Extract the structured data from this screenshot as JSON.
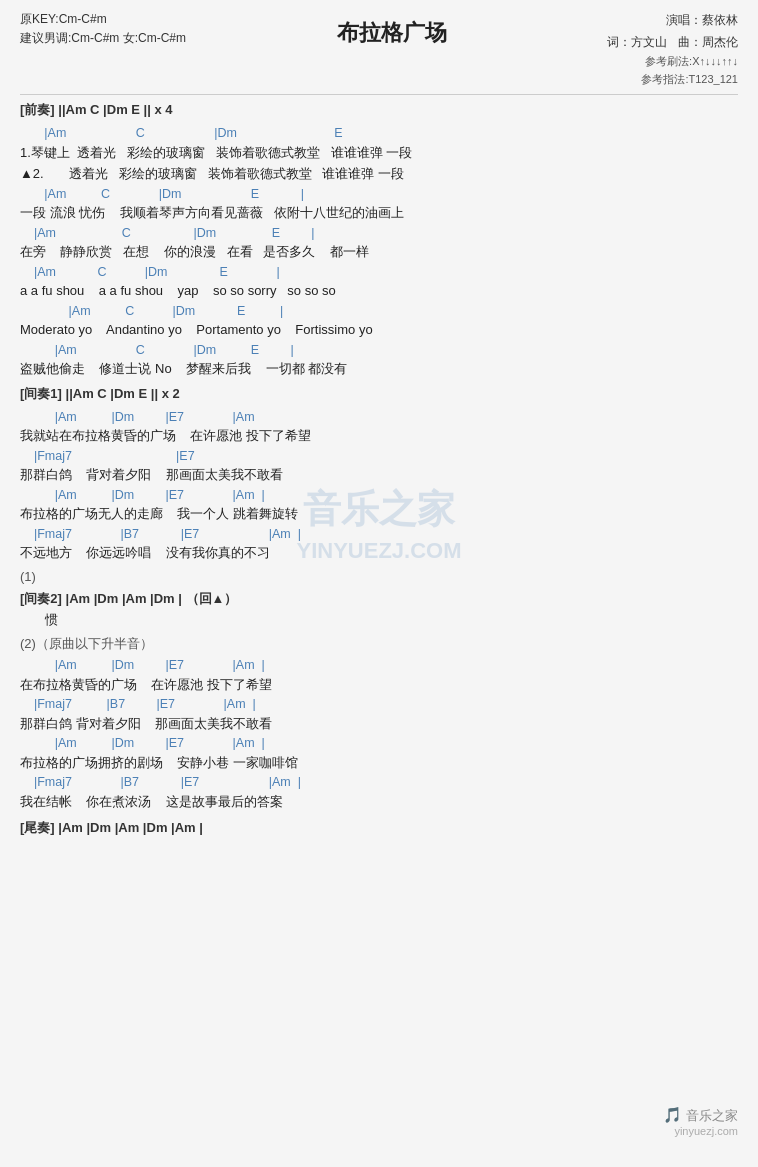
{
  "title": "布拉格广场",
  "meta": {
    "original_key": "原KEY:Cm-C#m",
    "suggested_key": "建议男调:Cm-C#m 女:Cm-C#m",
    "singer": "演唱：蔡依林",
    "lyricist": "词：方文山",
    "composer": "曲：周杰伦",
    "strumming_method": "参考刷法:X↑↓↓↓↑↑↓",
    "finger_method": "参考指法:T123_121"
  },
  "prelude": "[前奏] ||Am  C  |Dm  E  || x 4",
  "verse1_chords1": "       |Am                    C                    |Dm                            E",
  "verse1_lyric1": "1.琴键上  透着光   彩绘的玻璃窗   装饰着歌德式教堂   谁谁谁弹 一段",
  "verse1_lyric2": "▲2.       透着光   彩绘的玻璃窗   装饰着歌德式教堂   谁谁谁弹 一段",
  "verse1_chords2": "       |Am          C              |Dm                    E            |",
  "verse1_lyric3": "一段 流浪 忧伤    我顺着琴声方向看见蔷薇   依附十八世纪的油画上",
  "verse1_chords3": "    |Am                   C                  |Dm                E         |",
  "verse1_lyric4": "在旁    静静欣赏   在想    你的浪漫   在看   是否多久    都一样",
  "verse1_chords4": "    |Am            C           |Dm               E              |",
  "verse1_lyric5": "a a fu shou    a a fu shou    yap    so so sorry   so so so",
  "verse1_chords5": "              |Am          C           |Dm            E          |",
  "verse1_lyric6": "Moderato yo    Andantino yo    Portamento yo    Fortissimo yo",
  "verse1_chords6": "          |Am                 C              |Dm          E         |",
  "verse1_lyric7": "盗贼他偷走    修道士说 No    梦醒来后我    一切都 都没有",
  "interlude1": "[间奏1] ||Am  C  |Dm  E  || x 2",
  "chorus1_chords1": "          |Am          |Dm         |E7              |Am",
  "chorus1_lyric1": "我就站在布拉格黄昏的广场    在许愿池 投下了希望",
  "chorus1_chords2": "    |Fmaj7                              |E7",
  "chorus1_lyric2": "那群白鸽    背对着夕阳    那画面太美我不敢看",
  "chorus1_chords3": "          |Am          |Dm         |E7              |Am  |",
  "chorus1_lyric3": "布拉格的广场无人的走廊    我一个人 跳着舞旋转",
  "chorus1_chords4": "    |Fmaj7              |B7            |E7                    |Am  |",
  "chorus1_lyric4": "不远地方    你远远吟唱    没有我你真的不习",
  "note1": "(1)",
  "interlude2": "[间奏2] |Am  |Dm  |Am  |Dm  |  （回▲）",
  "interlude2_lyric": "       惯",
  "note2": "(2)（原曲以下升半音）",
  "chorus2_chords1": "          |Am          |Dm         |E7              |Am  |",
  "chorus2_lyric1": "在布拉格黄昏的广场    在许愿池 投下了希望",
  "chorus2_chords2": "    |Fmaj7          |B7         |E7              |Am  |",
  "chorus2_lyric2": "那群白鸽 背对着夕阳    那画面太美我不敢看",
  "chorus2_chords3": "          |Am          |Dm         |E7              |Am  |",
  "chorus2_lyric3": "布拉格的广场拥挤的剧场    安静小巷 一家咖啡馆",
  "chorus2_chords4": "    |Fmaj7              |B7            |E7                    |Am  |",
  "chorus2_lyric4": "我在结帐    你在煮浓汤    这是故事最后的答案",
  "outro": "[尾奏] |Am  |Dm  |Am  |Dm  |Am  |",
  "watermark_line1": "音乐之家",
  "watermark_line2": "YINYUEZJ.COM",
  "logo_bottom": "音乐之家",
  "url_bottom": "yinyuezj.com"
}
